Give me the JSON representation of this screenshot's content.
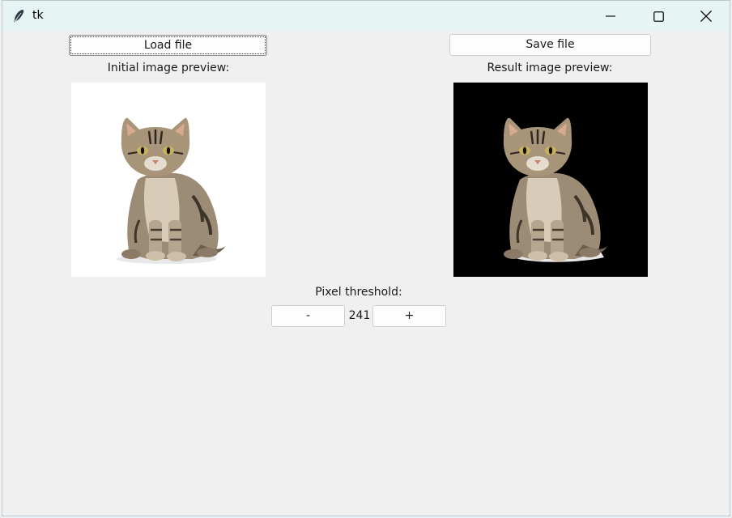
{
  "window": {
    "title": "tk",
    "controls": {
      "minimize_icon": "minimize-icon",
      "maximize_icon": "maximize-icon",
      "close_icon": "close-icon"
    }
  },
  "toolbar": {
    "load_label": "Load file",
    "save_label": "Save file"
  },
  "previews": {
    "initial_label": "Initial image preview:",
    "result_label": "Result image preview:",
    "initial_background": "#ffffff",
    "result_background": "#000000",
    "subject": "tabby-kitten-photo"
  },
  "threshold": {
    "label": "Pixel threshold:",
    "decrement_label": "-",
    "increment_label": "+",
    "value": "241"
  }
}
